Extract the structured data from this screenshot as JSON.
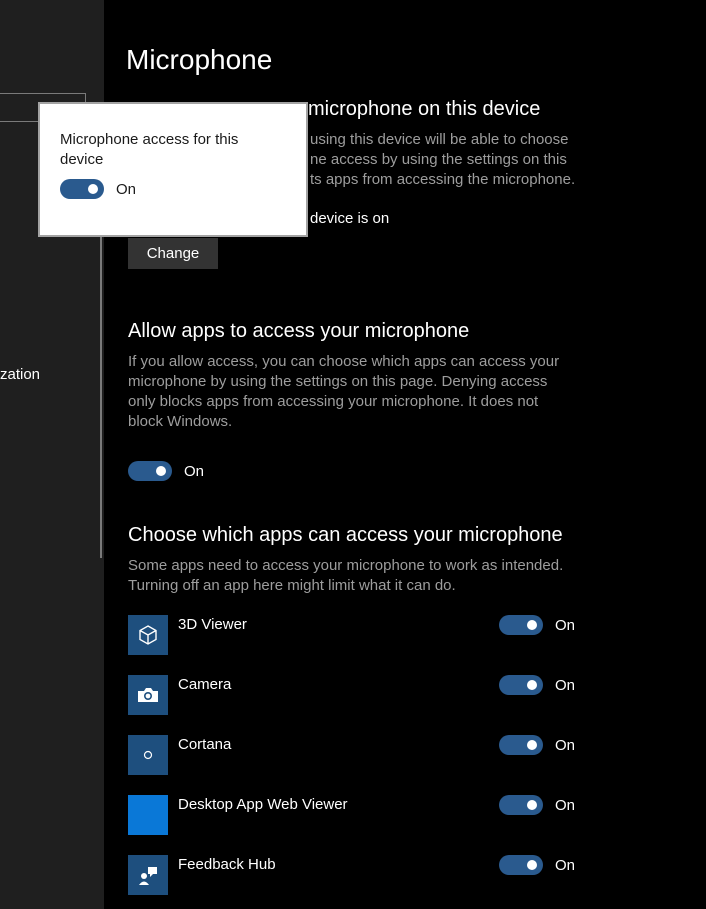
{
  "sidebar": {
    "fragment_text": "zation"
  },
  "page": {
    "title": "Microphone"
  },
  "device_section": {
    "heading_visible": "microphone on this device",
    "desc_lines": [
      "using this device will be able to choose",
      "ne access by using the settings on this",
      "ts apps from accessing the microphone."
    ],
    "status_visible": "device is on",
    "change_button_label": "Change"
  },
  "allow_apps_section": {
    "heading": "Allow apps to access your microphone",
    "desc_lines": [
      "If you allow access, you can choose which apps can access your",
      "microphone by using the settings on this page. Denying access",
      "only blocks apps from accessing your microphone. It does not",
      "block Windows."
    ],
    "toggle_state": "On",
    "toggle_on": 1
  },
  "choose_apps_section": {
    "heading": "Choose which apps can access your microphone",
    "desc_lines": [
      "Some apps need to access your microphone to work as intended.",
      "Turning off an app here might limit what it can do."
    ],
    "apps": [
      {
        "name": "3D Viewer",
        "icon": "cube-icon",
        "toggle_state": "On"
      },
      {
        "name": "Camera",
        "icon": "camera-icon",
        "toggle_state": "On"
      },
      {
        "name": "Cortana",
        "icon": "cortana-icon",
        "toggle_state": "On"
      },
      {
        "name": "Desktop App Web Viewer",
        "icon": "blank-tile-icon",
        "toggle_state": "On"
      },
      {
        "name": "Feedback Hub",
        "icon": "feedback-icon",
        "toggle_state": "On"
      }
    ]
  },
  "popup": {
    "title": "Microphone access for this device",
    "toggle_state": "On"
  },
  "colors": {
    "background": "#000000",
    "sidebar": "#1f1f1f",
    "toggle_on": "#2a5a8e",
    "app_tile": "#1e4f7e",
    "app_tile_bright": "#0a78d7",
    "description_text": "#9d9d9d"
  }
}
